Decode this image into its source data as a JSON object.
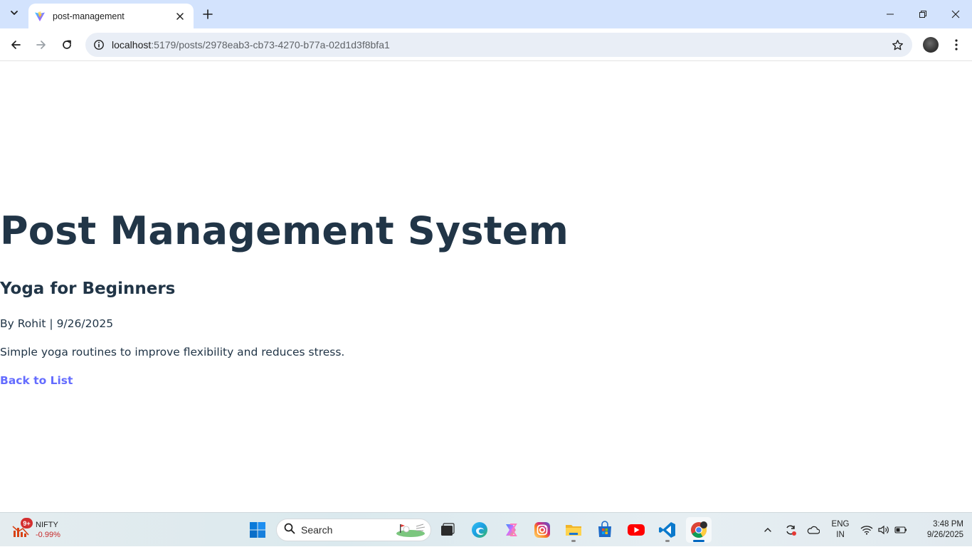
{
  "browser": {
    "tab_title": "post-management",
    "url_host": "localhost",
    "url_path": ":5179/posts/2978eab3-cb73-4270-b77a-02d1d3f8bfa1"
  },
  "page": {
    "app_title": "Post Management System",
    "post_title": "Yoga for Beginners",
    "post_meta": "By Rohit | 9/26/2025",
    "post_body": "Simple yoga routines to improve flexibility and reduces stress.",
    "back_link": "Back to List"
  },
  "taskbar": {
    "widget_badge": "9+",
    "widget_name": "NIFTY",
    "widget_value": "-0.99%",
    "search_placeholder": "Search",
    "language_line1": "ENG",
    "language_line2": "IN",
    "time": "3:48 PM",
    "date": "9/26/2025"
  },
  "colors": {
    "tabstrip": "#d3e3fd",
    "heading": "#213547",
    "link": "#646cff"
  },
  "icons": [
    "tab-search-icon",
    "vite-favicon-icon",
    "tab-close-icon",
    "new-tab-icon",
    "minimize-icon",
    "restore-icon",
    "close-window-icon",
    "back-icon",
    "forward-icon",
    "reload-icon",
    "site-info-icon",
    "bookmark-star-icon",
    "profile-avatar",
    "more-menu-icon",
    "windows-start-icon",
    "search-icon",
    "task-view-icon",
    "edge-icon",
    "copilot-icon",
    "instagram-icon",
    "file-explorer-icon",
    "store-icon",
    "youtube-icon",
    "vscode-icon",
    "chrome-icon",
    "chevron-up-icon",
    "sync-icon",
    "onedrive-icon",
    "wifi-icon",
    "volume-icon",
    "battery-icon"
  ]
}
